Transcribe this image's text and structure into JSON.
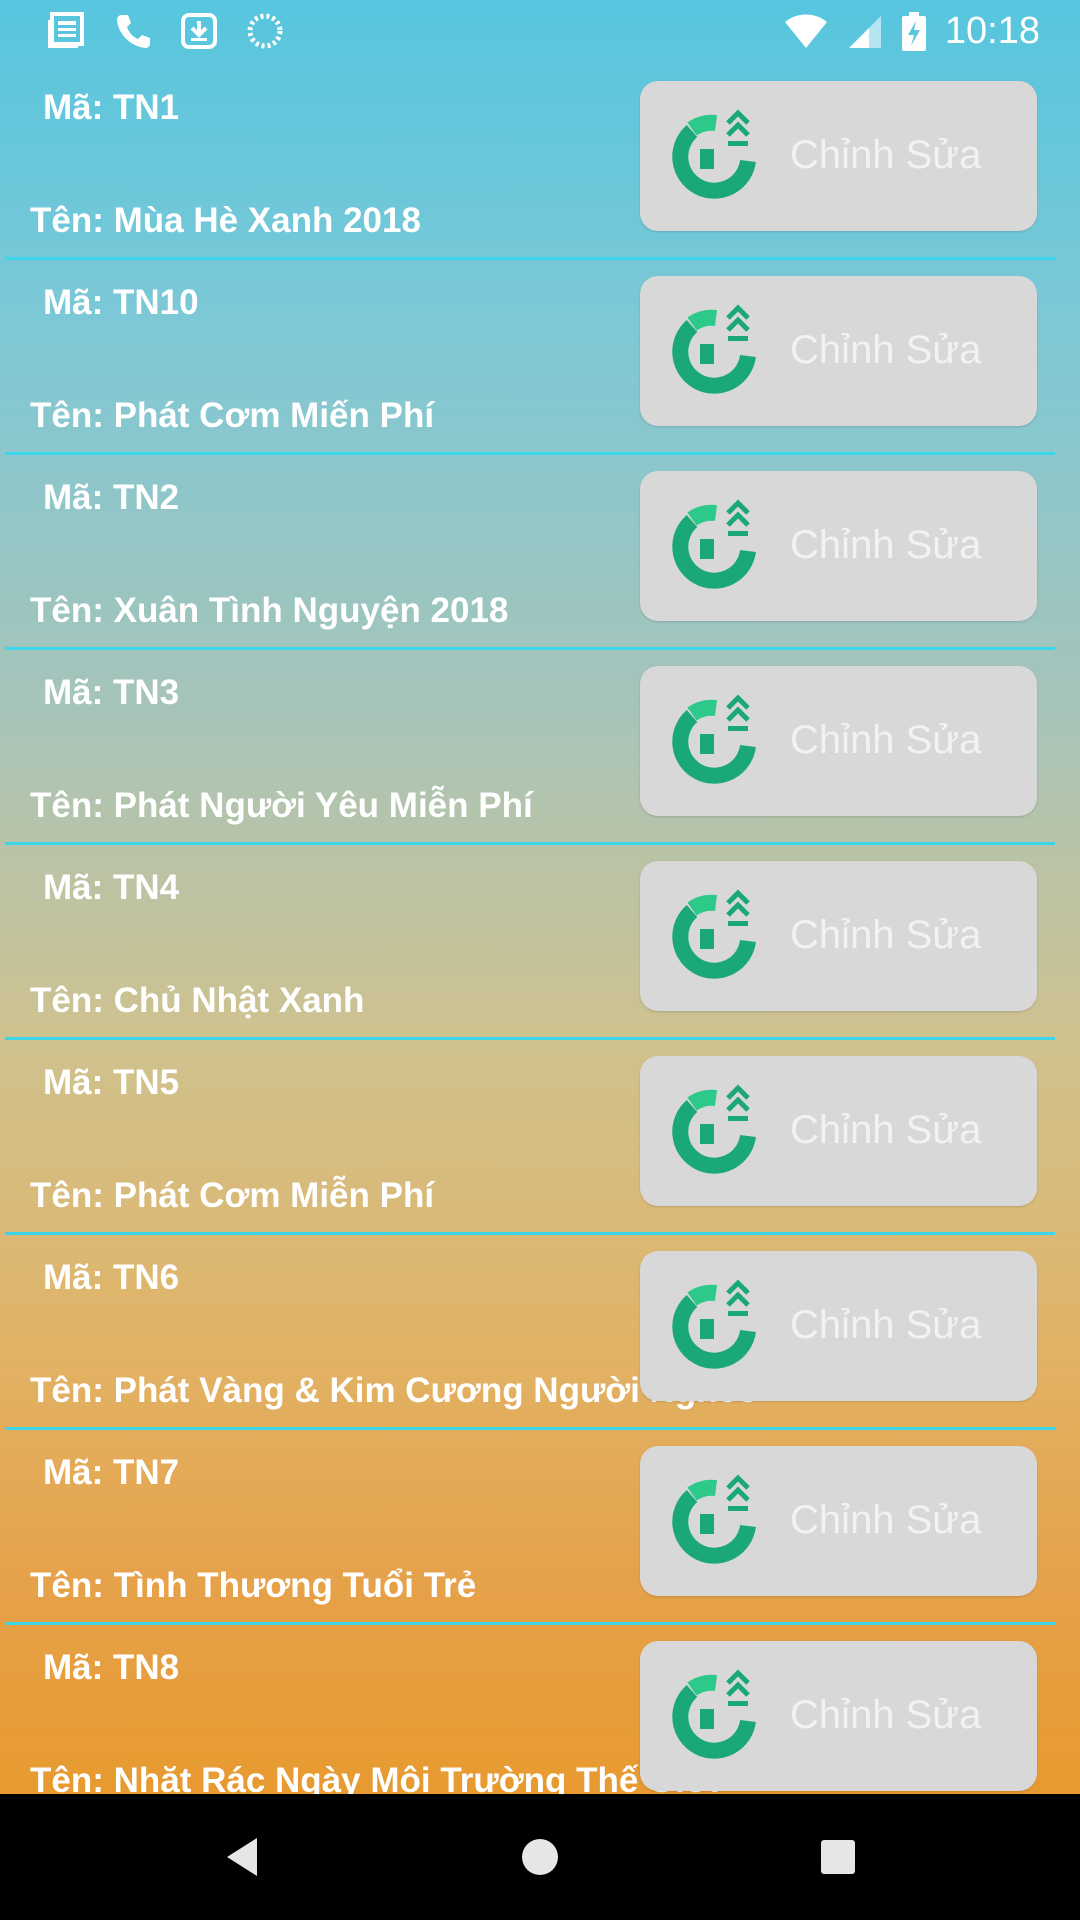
{
  "status_bar": {
    "time": "10:18",
    "left_icons": [
      "news-icon",
      "phone-icon",
      "download-icon",
      "loading-icon"
    ],
    "right_icons": [
      "wifi-icon",
      "signal-icon",
      "battery-charging-icon"
    ]
  },
  "edit_label": "Chỉnh Sửa",
  "items": [
    {
      "code": "Mã: TN1",
      "name": "Tên: Mùa Hè Xanh 2018"
    },
    {
      "code": "Mã: TN10",
      "name": "Tên: Phát Cơm Miến Phí"
    },
    {
      "code": "Mã: TN2",
      "name": "Tên: Xuân Tình Nguyện 2018"
    },
    {
      "code": "Mã: TN3",
      "name": "Tên: Phát Người Yêu Miễn Phí"
    },
    {
      "code": "Mã: TN4",
      "name": "Tên: Chủ Nhật Xanh"
    },
    {
      "code": "Mã: TN5",
      "name": "Tên: Phát Cơm Miễn Phí"
    },
    {
      "code": "Mã: TN6",
      "name": "Tên: Phát Vàng & Kim Cương Người Nghèo"
    },
    {
      "code": "Mã: TN7",
      "name": "Tên: Tình Thương Tuổi Trẻ"
    },
    {
      "code": "Mã: TN8",
      "name": "Tên: Nhặt Rác Ngày Môi Trường Thế Giới"
    }
  ],
  "nav": [
    "back-icon",
    "home-icon",
    "recents-icon"
  ],
  "colors": {
    "divider": "#3dd6e8",
    "logo_green": "#1aa878",
    "button_bg": "#d8d8d8"
  }
}
